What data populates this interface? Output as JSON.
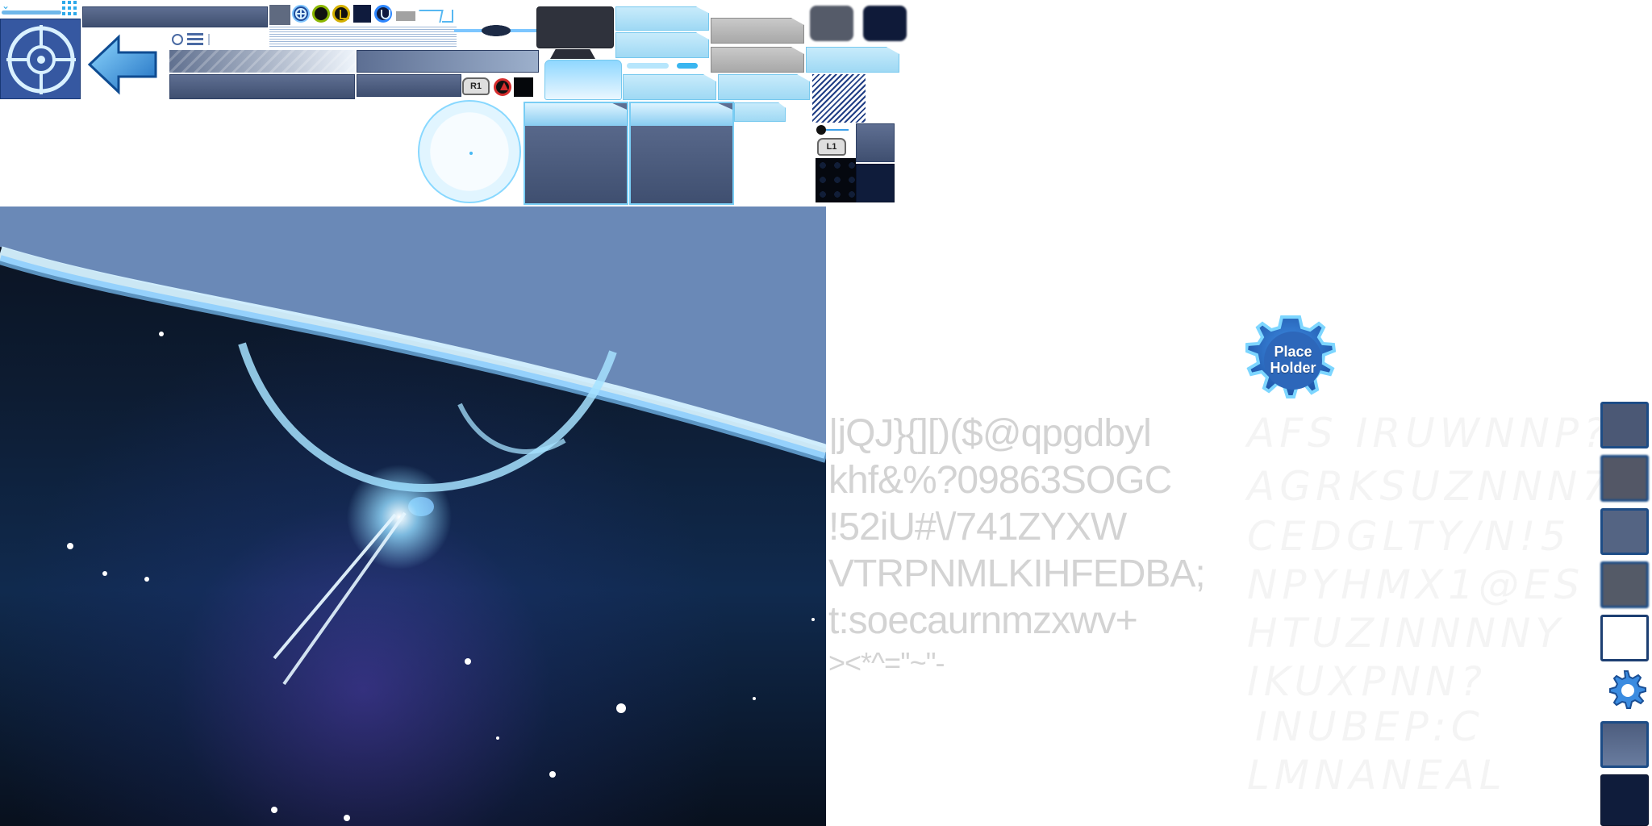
{
  "atlas": {
    "buttons": {
      "r1": "R1",
      "l1": "L1"
    },
    "placeholder": {
      "text": "Place\nHolder"
    },
    "font_samples": {
      "line1": "|jQJ}{][)($@qpgdbyl",
      "line2": "khf&%?09863SOGC",
      "line3": "!52iU#\\/741ZYXW",
      "line4": "VTRPNMLKIHFEDBA;",
      "line5": "t:soecaurnmzxwv+",
      "line6": "><*^=''~\"-"
    },
    "italic_samples": {
      "line1": "AFS IRUWNNP?",
      "line2": "AGRKSUZNNN7",
      "line3": "CEDGLTY/N!5",
      "line4": "NPYHMX1@ES",
      "line5": "HTUZINNNNY",
      "line6": "IKUXPNN?",
      "line7": "INUBEP:C",
      "line8": "LMNANEAL"
    }
  }
}
